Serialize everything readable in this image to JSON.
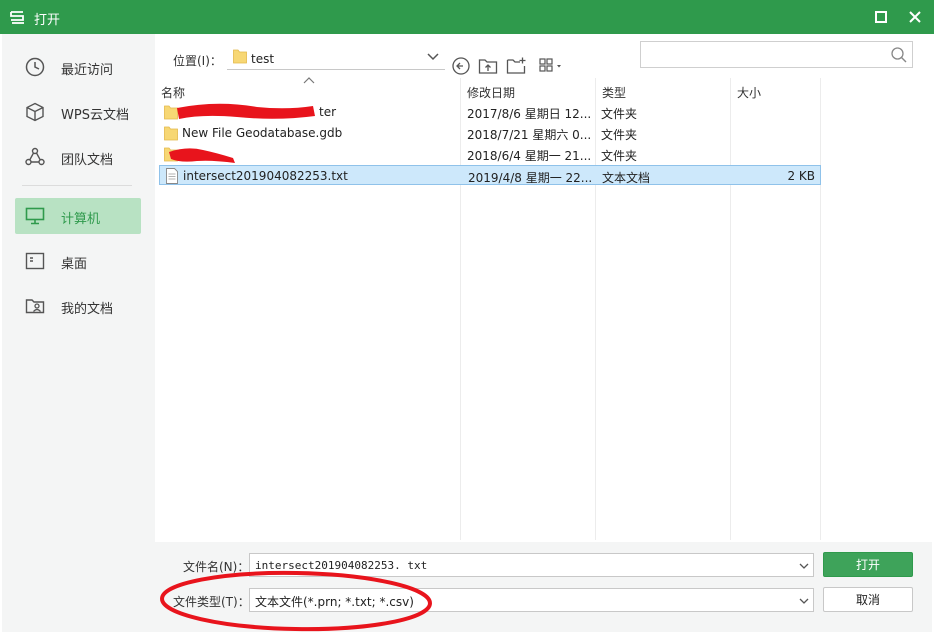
{
  "window": {
    "title": "打开",
    "logo_icon": "wps-s-logo-icon"
  },
  "sidebar": {
    "items": [
      {
        "label": "最近访问",
        "icon": "clock-icon"
      },
      {
        "label": "WPS云文档",
        "icon": "cube-icon"
      },
      {
        "label": "团队文档",
        "icon": "team-icon"
      },
      {
        "label": "计算机",
        "icon": "monitor-icon",
        "active": true
      },
      {
        "label": "桌面",
        "icon": "desktop-icon"
      },
      {
        "label": "我的文档",
        "icon": "user-folder-icon"
      }
    ]
  },
  "toolbar": {
    "location_label": "位置(I)：",
    "location_value": "test",
    "search_placeholder": ""
  },
  "columns": {
    "name": "名称",
    "date": "修改日期",
    "type": "类型",
    "size": "大小"
  },
  "files": [
    {
      "name": "ter",
      "date": "2017/8/6 星期日 12...",
      "type": "文件夹",
      "size": "",
      "kind": "folder",
      "redacted": true
    },
    {
      "name": "New File Geodatabase.gdb",
      "date": "2018/7/21 星期六 0...",
      "type": "文件夹",
      "size": "",
      "kind": "folder"
    },
    {
      "name": "",
      "date": "2018/6/4 星期一 21...",
      "type": "文件夹",
      "size": "",
      "kind": "folder",
      "redacted": true
    },
    {
      "name": "intersect201904082253.txt",
      "date": "2019/4/8 星期一 22...",
      "type": "文本文档",
      "size": "2 KB",
      "kind": "text",
      "selected": true
    }
  ],
  "bottom": {
    "filename_label": "文件名(N)：",
    "filename_value": "intersect201904082253. txt",
    "filetype_label": "文件类型(T)：",
    "filetype_value": "文本文件(*.prn; *.txt; *.csv)",
    "open_label": "打开",
    "cancel_label": "取消"
  },
  "colors": {
    "accent": "#2f9a4c",
    "selection": "#cde8fb",
    "annotation": "#e8141c"
  }
}
